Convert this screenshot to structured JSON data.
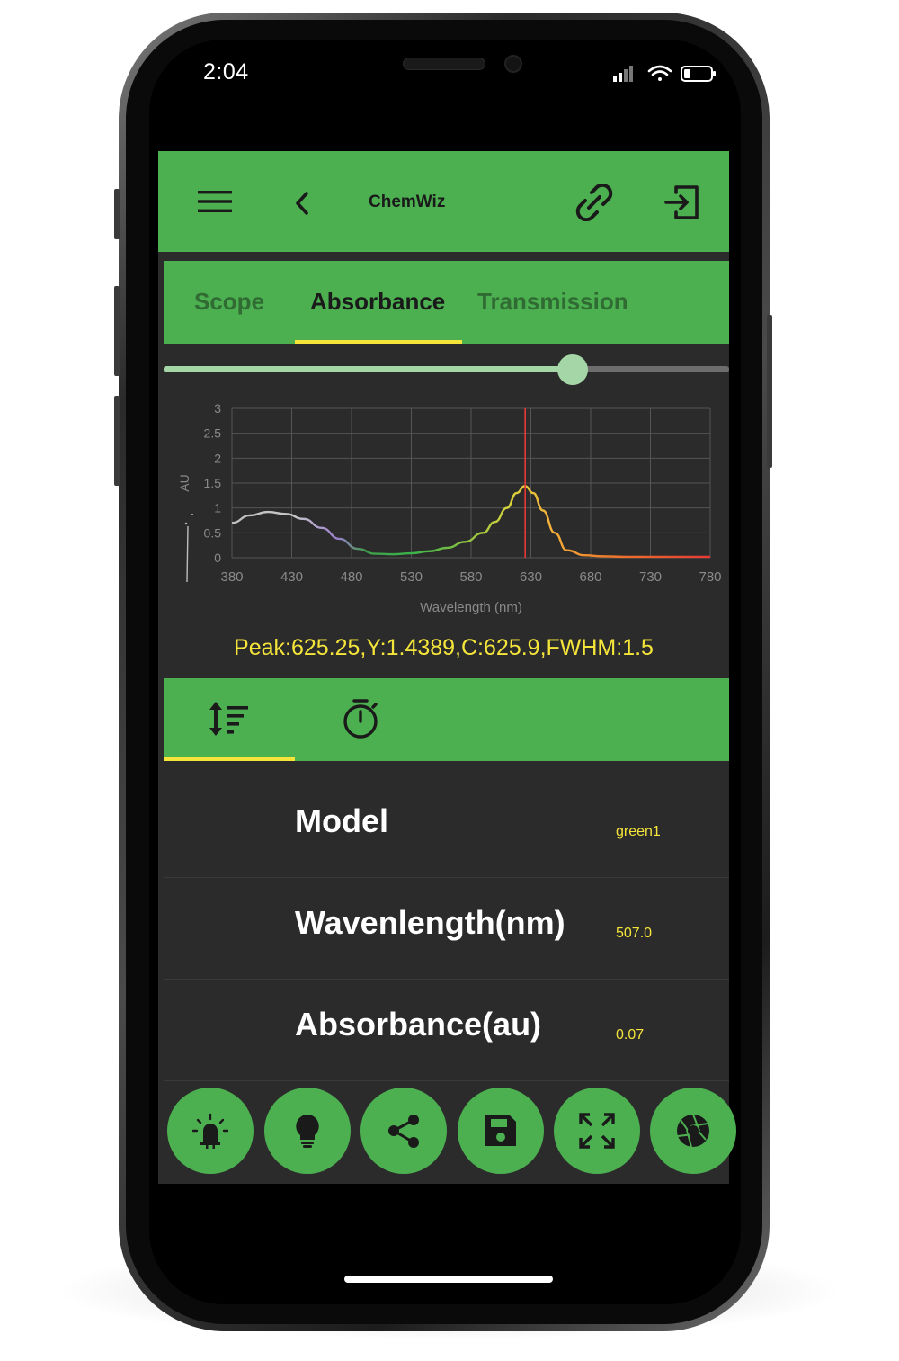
{
  "status_bar": {
    "time": "2:04"
  },
  "app_bar": {
    "title": "ChemWiz",
    "menu_icon": "menu-icon",
    "back_icon": "chevron-left-icon",
    "link_icon": "link-icon",
    "exit_icon": "exit-icon"
  },
  "tabs": [
    {
      "label": "Scope",
      "active": false
    },
    {
      "label": "Absorbance",
      "active": true
    },
    {
      "label": "Transmission",
      "active": false
    }
  ],
  "slider": {
    "value_fraction": 0.725
  },
  "chart_data": {
    "type": "line",
    "xlabel": "Wavelength (nm)",
    "ylabel": "AU",
    "xlim": [
      380,
      780
    ],
    "ylim": [
      0,
      3
    ],
    "x_ticks": [
      380,
      430,
      480,
      530,
      580,
      630,
      680,
      730,
      780
    ],
    "y_ticks": [
      "0",
      "0.5",
      "1",
      "1.5",
      "2",
      "2.5",
      "3"
    ],
    "grid": true,
    "marker_x": 625.25,
    "series": [
      {
        "x": [
          380,
          395,
          410,
          425,
          440,
          455,
          470,
          485,
          500,
          515,
          530,
          545,
          560,
          575,
          590,
          600,
          610,
          618,
          625,
          632,
          640,
          650,
          660,
          675,
          690,
          710,
          740,
          780
        ],
        "y": [
          0.7,
          0.85,
          0.92,
          0.88,
          0.78,
          0.6,
          0.38,
          0.18,
          0.08,
          0.07,
          0.09,
          0.13,
          0.2,
          0.32,
          0.5,
          0.72,
          1.0,
          1.3,
          1.44,
          1.3,
          0.95,
          0.5,
          0.15,
          0.05,
          0.03,
          0.02,
          0.02,
          0.02
        ]
      }
    ]
  },
  "peak_text": "Peak:625.25,Y:1.4389,C:625.9,FWHM:1.5",
  "sub_tabs": [
    {
      "icon": "sort-icon",
      "active": true
    },
    {
      "icon": "timer-icon",
      "active": false
    }
  ],
  "rows": [
    {
      "label": "Model",
      "value": "green1"
    },
    {
      "label": "Wavenlength(nm)",
      "value": "507.0"
    },
    {
      "label": "Absorbance(au)",
      "value": "0.07"
    }
  ],
  "fabs": [
    "led-icon",
    "lightbulb-icon",
    "share-icon",
    "save-icon",
    "fullscreen-icon",
    "camera-shutter-icon"
  ],
  "colors": {
    "primary": "#4caf50",
    "accent": "#f5e53a",
    "background": "#2b2b2b",
    "marker": "#e53935"
  }
}
